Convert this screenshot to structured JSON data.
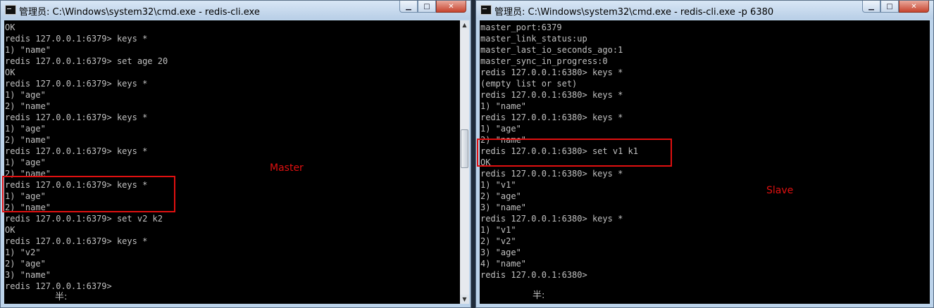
{
  "master": {
    "title": "管理员: C:\\Windows\\system32\\cmd.exe - redis-cli.exe",
    "lines": [
      "OK",
      "redis 127.0.0.1:6379> keys *",
      "1) \"name\"",
      "redis 127.0.0.1:6379> set age 20",
      "OK",
      "redis 127.0.0.1:6379> keys *",
      "1) \"age\"",
      "2) \"name\"",
      "redis 127.0.0.1:6379> keys *",
      "1) \"age\"",
      "2) \"name\"",
      "redis 127.0.0.1:6379> keys *",
      "1) \"age\"",
      "2) \"name\"",
      "redis 127.0.0.1:6379> keys *",
      "1) \"age\"",
      "2) \"name\"",
      "redis 127.0.0.1:6379> set v2 k2",
      "OK",
      "redis 127.0.0.1:6379> keys *",
      "1) \"v2\"",
      "2) \"age\"",
      "3) \"name\"",
      "redis 127.0.0.1:6379>"
    ],
    "ime_status": "半:",
    "annotation": "Master"
  },
  "slave": {
    "title": "管理员: C:\\Windows\\system32\\cmd.exe - redis-cli.exe  -p 6380",
    "lines": [
      "master_port:6379",
      "master_link_status:up",
      "master_last_io_seconds_ago:1",
      "master_sync_in_progress:0",
      "redis 127.0.0.1:6380> keys *",
      "(empty list or set)",
      "redis 127.0.0.1:6380> keys *",
      "1) \"name\"",
      "redis 127.0.0.1:6380> keys *",
      "1) \"age\"",
      "2) \"name\"",
      "redis 127.0.0.1:6380> set v1 k1",
      "OK",
      "redis 127.0.0.1:6380> keys *",
      "1) \"v1\"",
      "2) \"age\"",
      "3) \"name\"",
      "redis 127.0.0.1:6380> keys *",
      "1) \"v1\"",
      "2) \"v2\"",
      "3) \"age\"",
      "4) \"name\"",
      "redis 127.0.0.1:6380>"
    ],
    "ime_status": "半:",
    "annotation": "Slave"
  },
  "window_controls": {
    "minimize_icon": "minimize-icon",
    "maximize_icon": "maximize-icon",
    "close_icon": "close-icon"
  },
  "colors": {
    "console_bg": "#000000",
    "console_text": "#c0c0c0",
    "annotation_red": "#e01010"
  }
}
